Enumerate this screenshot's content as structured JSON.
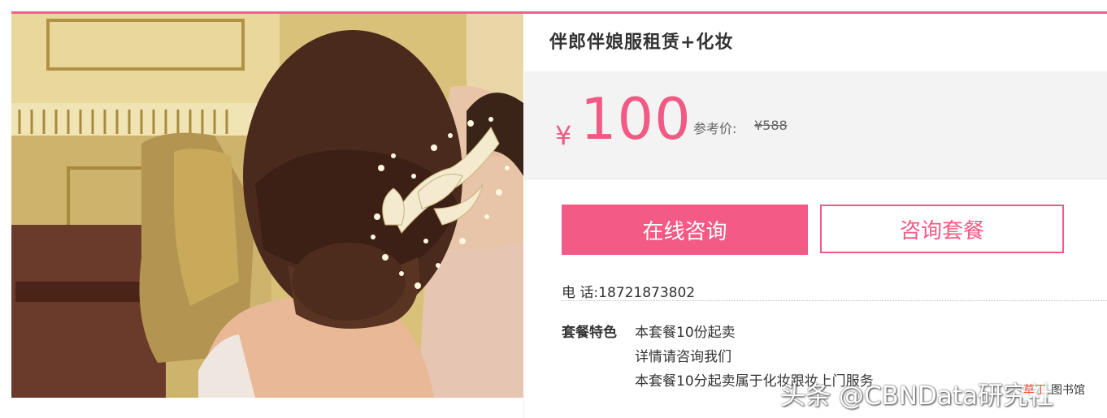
{
  "product": {
    "title": "伴郎伴娘服租赁+化妆",
    "currency_symbol": "¥",
    "price": "100",
    "reference_label": "参考价:",
    "reference_price": "¥588"
  },
  "buttons": {
    "consult_online": "在线咨询",
    "consult_package": "咨询套餐"
  },
  "contact": {
    "phone": "电 话:18721873802"
  },
  "features": {
    "label": "套餐特色",
    "lines": [
      "本套餐10份起卖",
      "详情请咨询我们",
      "本套餐10分起卖属于化妆跟妆上门服务"
    ]
  },
  "watermark": {
    "text": "头条 @CBNData研究社",
    "logo_a": "草丁",
    "logo_b": "图书馆"
  },
  "colors": {
    "accent": "#f35a85",
    "panel_bg": "#f3f3f3"
  }
}
